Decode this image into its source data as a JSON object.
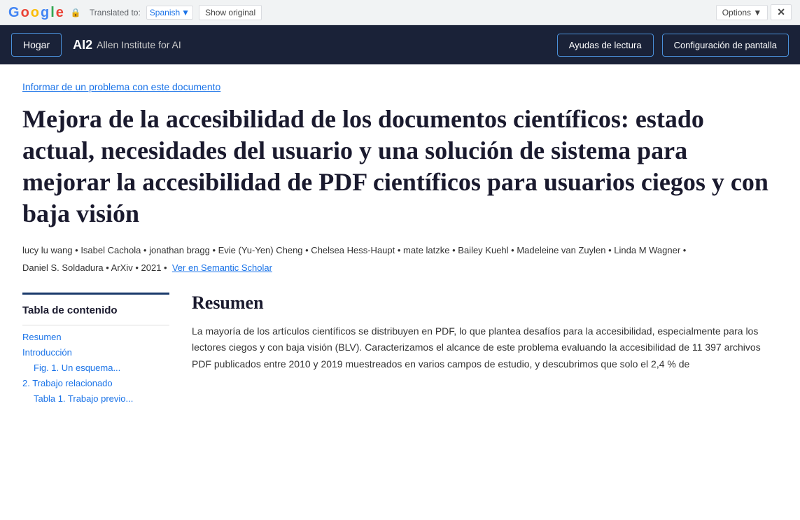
{
  "translation_bar": {
    "google_label": "Google",
    "translated_label": "Translated to:",
    "language": "Spanish",
    "show_original": "Show original",
    "options": "Options ▼",
    "close": "✕"
  },
  "nav": {
    "home_label": "Hogar",
    "logo_ai2": "AI2",
    "logo_text": "Allen Institute for AI",
    "reading_aids": "Ayudas de lectura",
    "display_settings": "Configuración de pantalla"
  },
  "page": {
    "report_link": "Informar de un problema con este documento",
    "title": "Mejora de la accesibilidad de los documentos científicos: estado actual, necesidades del usuario y una solución de sistema para mejorar la accesibilidad de PDF científicos para usuarios ciegos y con baja visión",
    "authors": "lucy lu wang • Isabel Cachola • jonathan bragg • Evie (Yu-Yen) Cheng • Chelsea Hess-Haupt • mate latzke • Bailey Kuehl • Madeleine van Zuylen • Linda M Wagner •",
    "authors2": "Daniel S. Soldadura • ArXiv • 2021 •",
    "semantic_scholar_link": "Ver en Semantic Scholar"
  },
  "toc": {
    "title": "Tabla de contenido",
    "items": [
      {
        "label": "Resumen",
        "sub": false
      },
      {
        "label": "Introducción",
        "sub": false
      },
      {
        "label": "Fig. 1. Un esquema...",
        "sub": true
      },
      {
        "label": "2. Trabajo relacionado",
        "sub": false
      },
      {
        "label": "Tabla 1. Trabajo previo...",
        "sub": true
      }
    ]
  },
  "abstract": {
    "title": "Resumen",
    "text": "La mayoría de los artículos científicos se distribuyen en PDF, lo que plantea desafíos para la accesibilidad, especialmente para los lectores ciegos y con baja visión (BLV). Caracterizamos el alcance de este problema evaluando la accesibilidad de 11 397 archivos PDF publicados entre 2010 y 2019 muestreados en varios campos de estudio, y descubrimos que solo el 2,4 % de"
  }
}
